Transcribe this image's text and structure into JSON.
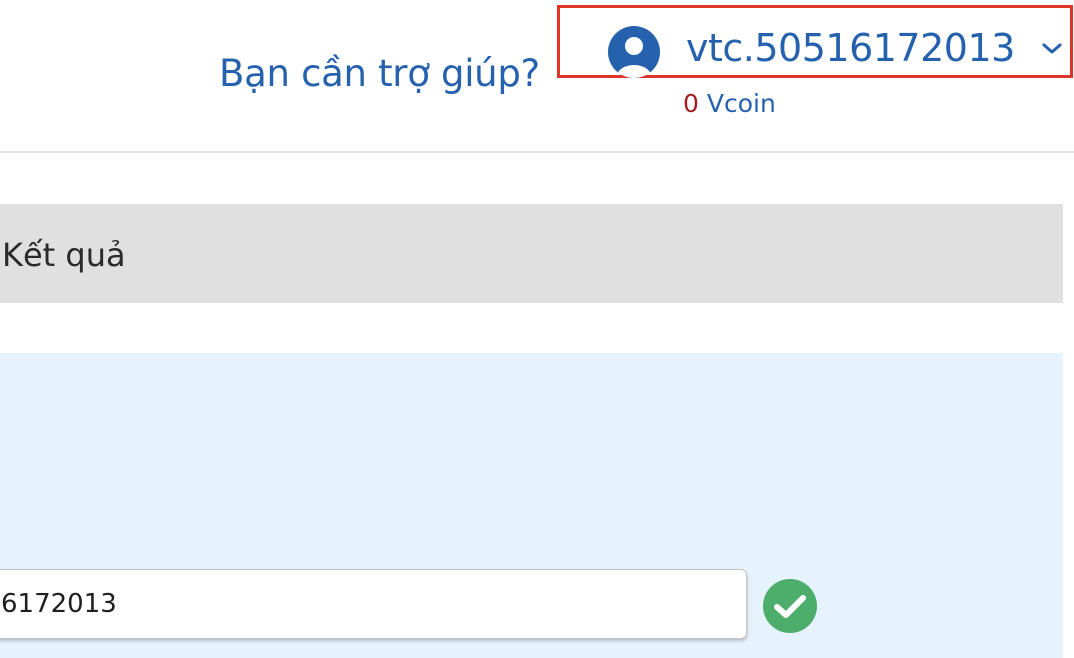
{
  "header": {
    "help_text": "Bạn cần trợ giúp?",
    "user": {
      "username": "vtc.50516172013",
      "avatar_icon": "user-circle-icon",
      "dropdown_icon": "chevron-down-icon"
    },
    "balance": {
      "amount": "0",
      "unit": "Vcoin"
    }
  },
  "result_section": {
    "title": "Kết quả"
  },
  "account_form": {
    "account_value": "6172013",
    "status_icon": "check-circle-icon"
  },
  "colors": {
    "brand_blue": "#2561ad",
    "highlight_red": "#e0342b",
    "amount_red": "#a11f1f",
    "success_green": "#4cae6a",
    "panel_background": "#e6f3fc",
    "result_bar_background": "#e0e0e0"
  }
}
